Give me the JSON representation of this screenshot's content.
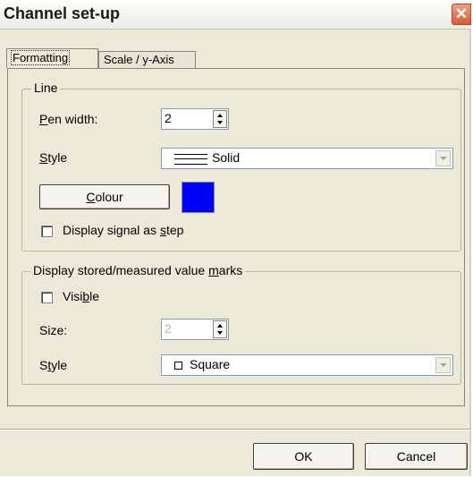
{
  "window": {
    "title": "Channel set-up",
    "close_glyph": "✕"
  },
  "tabs": [
    {
      "label": "Formatting",
      "active": true
    },
    {
      "label": "Scale / y-Axis",
      "active": false
    }
  ],
  "line_group": {
    "legend": "Line",
    "pen_width_label_u": "P",
    "pen_width_label_rest": "en width:",
    "pen_width_value": "2",
    "style_label_u": "S",
    "style_label_rest": "tyle",
    "style_value": "Solid",
    "colour_button_u": "C",
    "colour_button_rest": "olour",
    "colour_swatch": "#0000ff",
    "step_checkbox_pre": "Display signal as ",
    "step_checkbox_u": "s",
    "step_checkbox_post": "tep",
    "step_checked": false
  },
  "marks_group": {
    "legend_pre": "Display stored/measured value ",
    "legend_u": "m",
    "legend_post": "arks",
    "visible_pre": "Visi",
    "visible_u": "b",
    "visible_post": "le",
    "visible_checked": false,
    "size_label": "Size:",
    "size_value": "2",
    "style_label_pre": "S",
    "style_label_u": "t",
    "style_label_post": "yle",
    "style_value": "Square"
  },
  "footer": {
    "ok_label": "OK",
    "cancel_label": "Cancel"
  },
  "colors": {
    "dialog_bg": "#ece9d8",
    "swatch": "#0000ff",
    "close_button": "#d85a3a"
  },
  "icons": {
    "close": "close-icon",
    "spin": "spin-arrows-icon",
    "dropdown": "chevron-down-icon",
    "line_sample": "solid-line-icon",
    "square_sample": "square-marker-icon"
  }
}
